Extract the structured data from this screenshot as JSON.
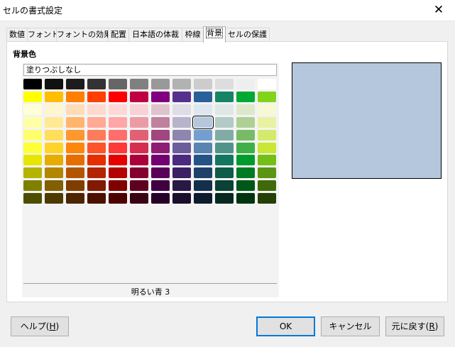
{
  "window": {
    "title": "セルの書式設定",
    "close_glyph": "✕"
  },
  "tabs": [
    {
      "label": "数値"
    },
    {
      "label": "フォント"
    },
    {
      "label": "フォントの効果"
    },
    {
      "label": "配置"
    },
    {
      "label": "日本語の体裁"
    },
    {
      "label": "枠線"
    },
    {
      "label": "背景"
    },
    {
      "label": "セルの保護"
    }
  ],
  "active_tab": "背景",
  "background": {
    "group_label": "背景色",
    "no_fill_label": "塗りつぶしなし",
    "selected_color_name": "明るい青 3",
    "preview_color": "#b4c7dc",
    "palette": [
      [
        "#000000",
        "#111111",
        "#1c1c1c",
        "#333333",
        "#666666",
        "#808080",
        "#999999",
        "#b2b2b2",
        "#cccccc",
        "#dddddd",
        "#eeeeee",
        "#ffffff"
      ],
      [
        "#ffff00",
        "#ffbf00",
        "#ff8000",
        "#ff4000",
        "#ff0000",
        "#bf0041",
        "#800080",
        "#55308d",
        "#2a6099",
        "#158466",
        "#00a933",
        "#81d41a"
      ],
      [
        "#ffffd7",
        "#fff5ce",
        "#ffdbb6",
        "#ffd8ce",
        "#ffd7d7",
        "#f7d1d5",
        "#e0c2cd",
        "#dedce6",
        "#dee6ef",
        "#dee7e5",
        "#dde8cb",
        "#f6f9d4"
      ],
      [
        "#ffffa6",
        "#ffe994",
        "#ffb66c",
        "#ffaa95",
        "#ffa6a6",
        "#ec9ba4",
        "#bf819e",
        "#b7b3ca",
        "#b4c7dc",
        "#b3cac7",
        "#afd095",
        "#e8f2a1"
      ],
      [
        "#ffff6d",
        "#ffde59",
        "#ff972f",
        "#ff7b59",
        "#ff6d6d",
        "#e16173",
        "#a1467e",
        "#8e86ae",
        "#729fcf",
        "#81aca6",
        "#77bc65",
        "#d4ea6b"
      ],
      [
        "#ffff38",
        "#ffd428",
        "#ff860d",
        "#ff5429",
        "#ff3838",
        "#d62e4e",
        "#8d1d75",
        "#6b5e9b",
        "#5983b0",
        "#50938a",
        "#3faf46",
        "#c9e734"
      ],
      [
        "#e6e600",
        "#e6ac00",
        "#e66d00",
        "#e62e00",
        "#e60000",
        "#ac003a",
        "#730073",
        "#4b2a7f",
        "#245487",
        "#127660",
        "#009b2e",
        "#73bf16"
      ],
      [
        "#b3b300",
        "#b38600",
        "#b35500",
        "#b32400",
        "#b30000",
        "#86002e",
        "#5a005a",
        "#3b2063",
        "#1c426a",
        "#0e5c4a",
        "#007a24",
        "#5a9611"
      ],
      [
        "#808000",
        "#806000",
        "#803d00",
        "#801a00",
        "#800000",
        "#600021",
        "#400040",
        "#2a1746",
        "#142f4c",
        "#0a4235",
        "#00571a",
        "#40690c"
      ],
      [
        "#4d4d00",
        "#4d3a00",
        "#4d2500",
        "#4d1000",
        "#4d0000",
        "#3a0014",
        "#270027",
        "#1a0e2a",
        "#0c1c2e",
        "#062820",
        "#003410",
        "#263f07"
      ]
    ],
    "selected_swatch": {
      "row": 3,
      "col": 8
    }
  },
  "buttons": {
    "help": {
      "label": "ヘルプ(",
      "mnemonic": "H",
      "suffix": ")"
    },
    "ok": {
      "label": "OK"
    },
    "cancel": {
      "label": "キャンセル"
    },
    "reset": {
      "label": "元に戻す(",
      "mnemonic": "R",
      "suffix": ")"
    }
  }
}
